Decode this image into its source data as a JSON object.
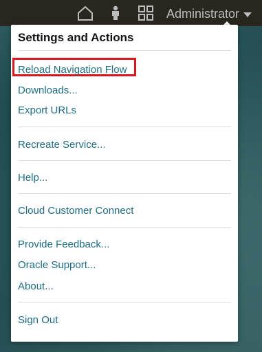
{
  "header": {
    "icons": [
      "home-icon",
      "person-icon",
      "grid-icon"
    ],
    "user_label": "Administrator",
    "background_color": "#29261f"
  },
  "menu": {
    "title": "Settings and Actions",
    "groups": [
      [
        "Reload Navigation Flow",
        "Downloads...",
        "Export URLs"
      ],
      [
        "Recreate Service..."
      ],
      [
        "Help..."
      ],
      [
        "Cloud Customer Connect"
      ],
      [
        "Provide Feedback...",
        "Oracle Support...",
        "About..."
      ],
      [
        "Sign Out"
      ]
    ],
    "highlighted_item": "Reload Navigation Flow",
    "highlight_color": "#d9151f",
    "link_color": "#1f6c84"
  }
}
